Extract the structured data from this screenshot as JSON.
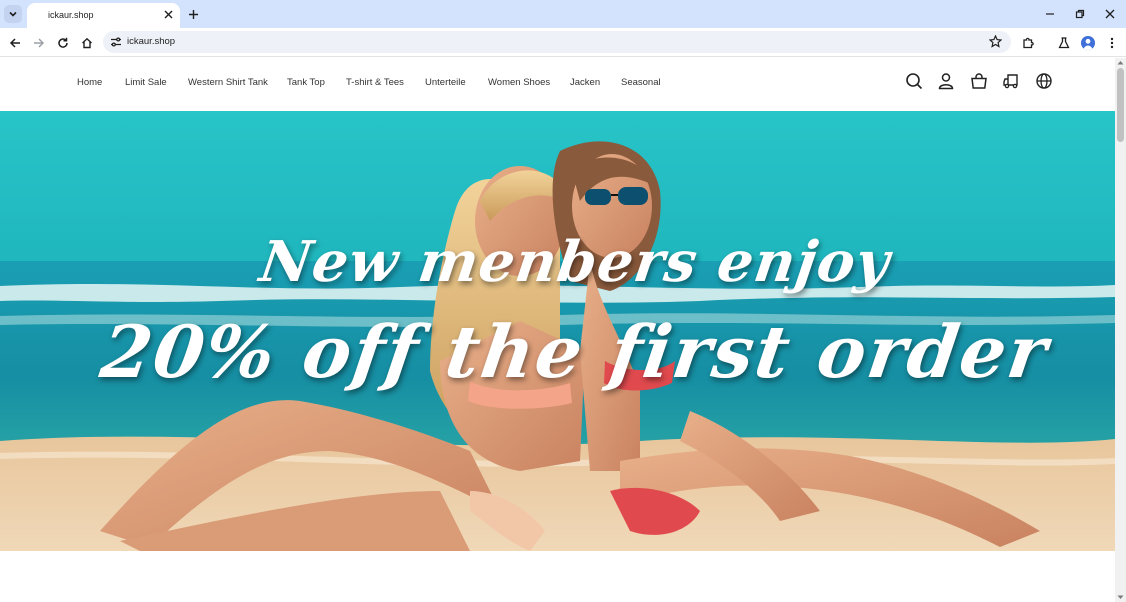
{
  "browser": {
    "tab_title": "ickaur.shop",
    "url": "ickaur.shop"
  },
  "nav": {
    "items": [
      {
        "label": "Home"
      },
      {
        "label": "Limit Sale"
      },
      {
        "label": "Western Shirt Tank"
      },
      {
        "label": "Tank Top"
      },
      {
        "label": "T-shirt & Tees"
      },
      {
        "label": "Unterteile"
      },
      {
        "label": "Women Shoes"
      },
      {
        "label": "Jacken"
      },
      {
        "label": "Seasonal"
      }
    ],
    "icons": [
      "search-icon",
      "account-icon",
      "cart-icon",
      "shipping-icon",
      "globe-icon"
    ]
  },
  "hero": {
    "line1": "New menbers enjoy",
    "line2": "20% off the first order"
  },
  "colors": {
    "chrome_bg": "#d3e3fd",
    "sea": "#1aa7b8",
    "sand": "#e9cba1"
  }
}
